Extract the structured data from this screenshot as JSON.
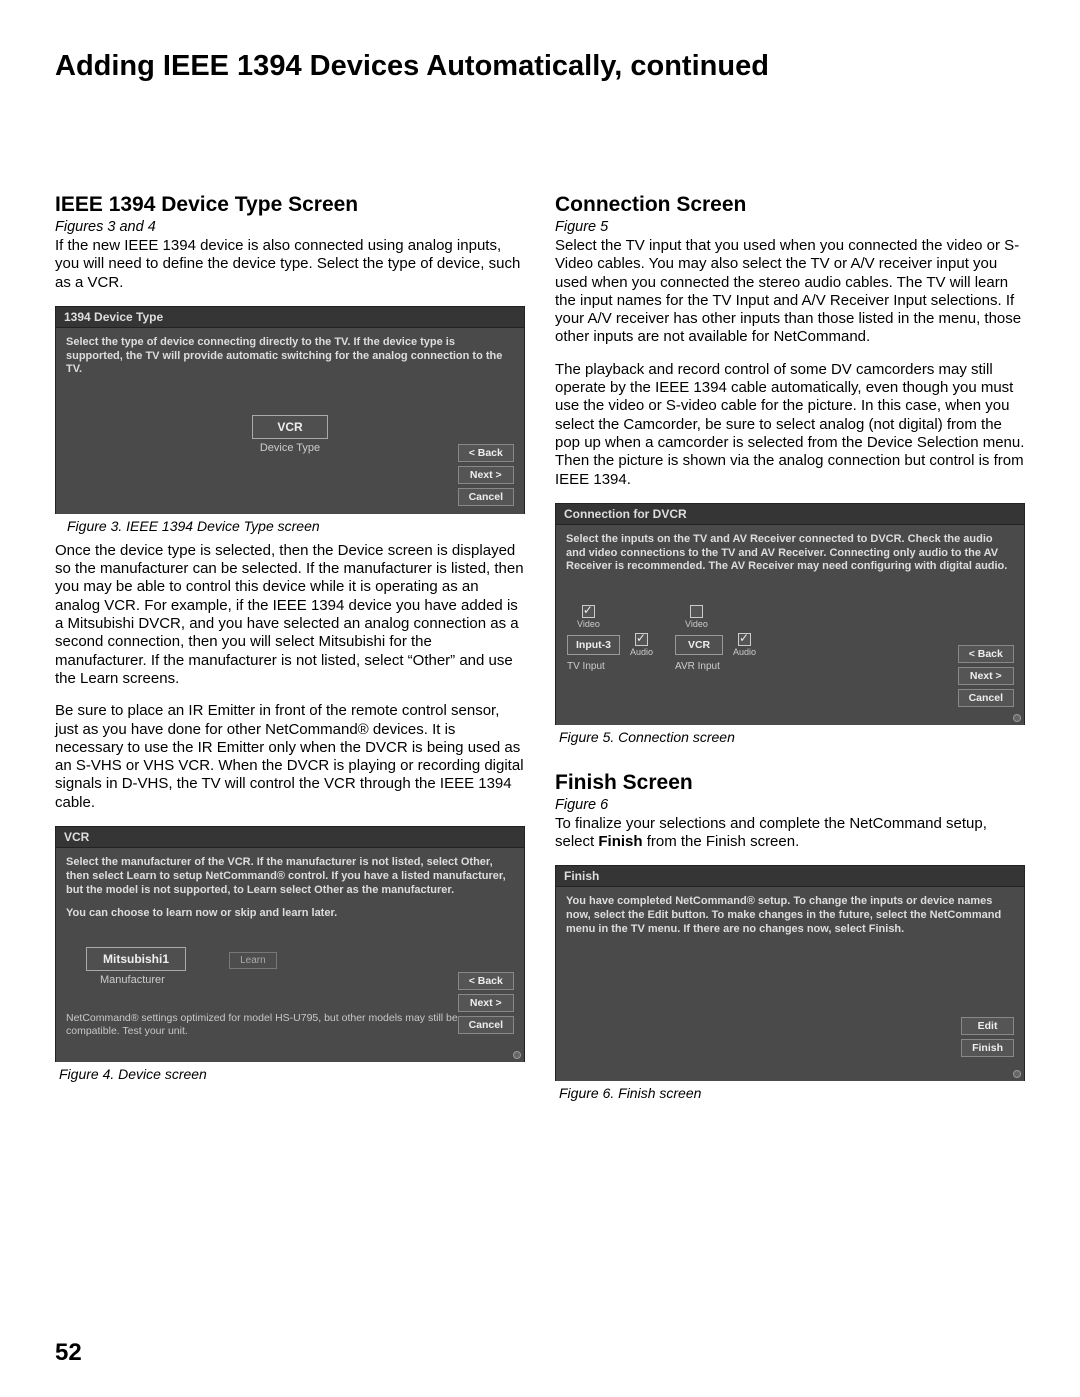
{
  "page_title": "Adding IEEE 1394 Devices Automatically, continued",
  "page_number": "52",
  "left": {
    "sec1": {
      "head": "IEEE 1394 Device Type Screen",
      "figref": "Figures 3 and 4",
      "p1": "If the new IEEE 1394 device is also connected using analog inputs, you will need to define the device type. Select the type of device, such as a VCR.",
      "p2": "Once the device type is selected, then the Device screen is displayed so the manufacturer can be selected. If the manufacturer is listed, then you may be able to control this device while it is operating as an analog VCR.  For example, if the IEEE 1394 device you have added is a Mitsubishi DVCR, and you have selected an analog connection as a second connection, then you will select Mitsubishi for the manufacturer.  If the manufacturer is not listed, select “Other” and use the Learn screens.",
      "p3": "Be sure to place an IR Emitter in front of the remote control sensor, just as you have done for other NetCommand® devices.  It is necessary to use the IR Emitter only when the DVCR is being used as an S-VHS or VHS VCR.  When the DVCR is playing or recording digital signals in D-VHS, the TV will control the VCR through the IEEE 1394 cable."
    },
    "fig3": {
      "title": "1394 Device Type",
      "instruct": "Select the type of device connecting directly to the TV.  If the device type is supported, the TV will provide automatic switching for the analog connection to the TV.",
      "sel_value": "VCR",
      "sel_label": "Device Type",
      "btn_back": "< Back",
      "btn_next": "Next >",
      "btn_cancel": "Cancel",
      "caption": "Figure 3. IEEE 1394 Device Type screen"
    },
    "fig4": {
      "title": "VCR",
      "instruct": "Select the manufacturer of the VCR.   If the manufacturer is not listed, select Other, then select Learn to setup NetCommand® control. If you have a listed manufacturer, but the model is not supported, to Learn select Other as the manufacturer.",
      "sub": "You can choose to learn now or skip and learn later.",
      "sel_value": "Mitsubishi1",
      "sel_label": "Manufacturer",
      "learn": "Learn",
      "note": "NetCommand® settings optimized for model HS-U795, but other models may still be compatible. Test your unit.",
      "btn_back": "< Back",
      "btn_next": "Next >",
      "btn_cancel": "Cancel",
      "caption": "Figure 4.  Device  screen"
    }
  },
  "right": {
    "sec1": {
      "head": "Connection Screen",
      "figref": "Figure 5",
      "p1": "Select the TV input that you used when you connected the video or S-Video cables.  You may also select the TV or A/V receiver input you used when you connected the stereo audio cables.  The TV will learn the input names for the TV Input and A/V Receiver Input selections.  If your A/V receiver has other inputs than those listed in the menu, those other inputs are not available for NetCommand.",
      "p2": "The playback and record control of some DV camcorders may still operate by the IEEE 1394 cable automatically, even though you must use the video or S-video cable for the picture.  In this case, when you select the Camcorder, be sure to select analog (not digital) from the pop up when a camcorder is selected from the Device Selection menu.  Then the picture is shown via the analog connection but control is from IEEE 1394."
    },
    "fig5": {
      "title": "Connection for DVCR",
      "instruct": "Select the inputs on the TV and AV Receiver connected to DVCR.  Check the audio and video connections to the TV and AV Receiver.  Connecting only audio to the AV Receiver is recommended.  The AV Receiver may need configuring with digital audio.",
      "tv_val": "Input-3",
      "tv_label": "TV Input",
      "avr_val": "VCR",
      "avr_label": "AVR Input",
      "col_video": "Video",
      "col_audio": "Audio",
      "btn_back": "< Back",
      "btn_next": "Next >",
      "btn_cancel": "Cancel",
      "caption": "Figure 5. Connection screen"
    },
    "sec2": {
      "head": "Finish Screen",
      "figref": "Figure 6",
      "p1_a": "To finalize your selections and complete the NetCommand setup, select ",
      "p1_b": "Finish",
      "p1_c": " from the Finish screen."
    },
    "fig6": {
      "title": "Finish",
      "instruct": "You have completed NetCommand® setup.  To change the inputs or device names now, select the Edit button.  To make changes in the future, select the NetCommand menu in the TV menu.  If there are no changes now, select Finish.",
      "btn_edit": "Edit",
      "btn_finish": "Finish",
      "caption": "Figure 6. Finish screen"
    }
  }
}
